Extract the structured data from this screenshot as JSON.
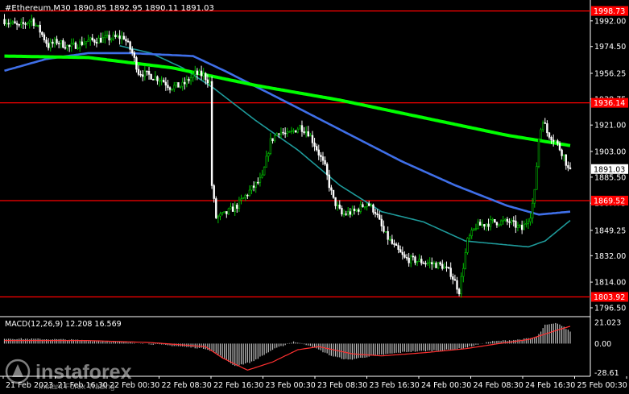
{
  "chart_data": {
    "type": "candlestick",
    "symbol_header": "#Ethereum,M30  1890.85 1892.95 1890.11 1891.03",
    "y_ticks": [
      "1992.00",
      "1974.50",
      "1956.25",
      "1938.75",
      "1921.00",
      "1903.00",
      "1885.50",
      "1867.75",
      "1849.25",
      "1832.00",
      "1814.00",
      "1796.50"
    ],
    "y_range": [
      1791.0,
      2004.0
    ],
    "current_price": "1891.03",
    "x_labels": [
      "21 Feb 2023",
      "21 Feb 16:30",
      "22 Feb 00:30",
      "22 Feb 08:30",
      "22 Feb 16:30",
      "23 Feb 00:30",
      "23 Feb 08:30",
      "23 Feb 16:30",
      "24 Feb 00:30",
      "24 Feb 08:30",
      "24 Feb 16:30",
      "25 Feb 00:30",
      "25 Feb 08:30"
    ],
    "levels": [
      {
        "value": 1998.73,
        "label": "1998.73"
      },
      {
        "value": 1936.14,
        "label": "1936.14"
      },
      {
        "value": 1869.52,
        "label": "1869.52"
      },
      {
        "value": 1803.92,
        "label": "1803.92"
      }
    ],
    "price_anchors": [
      [
        0,
        1993
      ],
      [
        8,
        1988
      ],
      [
        14,
        1993
      ],
      [
        18,
        1985
      ],
      [
        22,
        1975
      ],
      [
        26,
        1978
      ],
      [
        32,
        1974
      ],
      [
        40,
        1978
      ],
      [
        50,
        1980
      ],
      [
        58,
        1981
      ],
      [
        62,
        1970
      ],
      [
        65,
        1957
      ],
      [
        70,
        1955
      ],
      [
        76,
        1952
      ],
      [
        80,
        1947
      ],
      [
        86,
        1948
      ],
      [
        92,
        1956
      ],
      [
        96,
        1955
      ],
      [
        99,
        1950
      ],
      [
        100,
        1880
      ],
      [
        102,
        1858
      ],
      [
        106,
        1860
      ],
      [
        112,
        1866
      ],
      [
        118,
        1876
      ],
      [
        124,
        1885
      ],
      [
        128,
        1910
      ],
      [
        132,
        1917
      ],
      [
        136,
        1914
      ],
      [
        142,
        1920
      ],
      [
        146,
        1916
      ],
      [
        150,
        1905
      ],
      [
        154,
        1892
      ],
      [
        156,
        1880
      ],
      [
        158,
        1870
      ],
      [
        162,
        1860
      ],
      [
        168,
        1862
      ],
      [
        174,
        1868
      ],
      [
        178,
        1862
      ],
      [
        182,
        1848
      ],
      [
        186,
        1840
      ],
      [
        192,
        1830
      ],
      [
        200,
        1828
      ],
      [
        210,
        1825
      ],
      [
        214,
        1820
      ],
      [
        218,
        1808
      ],
      [
        220,
        1825
      ],
      [
        222,
        1842
      ],
      [
        226,
        1852
      ],
      [
        234,
        1855
      ],
      [
        242,
        1855
      ],
      [
        248,
        1850
      ],
      [
        252,
        1860
      ],
      [
        254,
        1875
      ],
      [
        256,
        1912
      ],
      [
        258,
        1925
      ],
      [
        260,
        1916
      ],
      [
        264,
        1910
      ],
      [
        268,
        1900
      ],
      [
        270,
        1891
      ]
    ],
    "ma_green": [
      [
        0,
        1968
      ],
      [
        40,
        1967
      ],
      [
        80,
        1960
      ],
      [
        120,
        1948
      ],
      [
        160,
        1938
      ],
      [
        200,
        1926
      ],
      [
        240,
        1914
      ],
      [
        270,
        1907
      ]
    ],
    "ma_blue": [
      [
        0,
        1958
      ],
      [
        20,
        1966
      ],
      [
        40,
        1970
      ],
      [
        60,
        1970
      ],
      [
        90,
        1968
      ],
      [
        105,
        1958
      ],
      [
        130,
        1940
      ],
      [
        160,
        1918
      ],
      [
        190,
        1896
      ],
      [
        215,
        1880
      ],
      [
        240,
        1866
      ],
      [
        255,
        1860
      ],
      [
        270,
        1862
      ]
    ],
    "ma_teal": [
      [
        55,
        1975
      ],
      [
        70,
        1970
      ],
      [
        85,
        1960
      ],
      [
        100,
        1946
      ],
      [
        120,
        1924
      ],
      [
        140,
        1904
      ],
      [
        160,
        1880
      ],
      [
        180,
        1862
      ],
      [
        200,
        1855
      ],
      [
        220,
        1842
      ],
      [
        235,
        1840
      ],
      [
        250,
        1838
      ],
      [
        258,
        1842
      ],
      [
        270,
        1856
      ]
    ],
    "macd": {
      "header": "MACD(12,26,9) 12.208 16.569",
      "y_ticks": [
        "21.023",
        "0.00",
        "-28.61"
      ],
      "y_range": [
        -32,
        24
      ],
      "hist_anchors": [
        [
          0,
          5
        ],
        [
          30,
          4
        ],
        [
          60,
          1
        ],
        [
          80,
          -2
        ],
        [
          96,
          -5
        ],
        [
          100,
          -8
        ],
        [
          110,
          -22
        ],
        [
          118,
          -18
        ],
        [
          128,
          -6
        ],
        [
          138,
          2
        ],
        [
          146,
          -2
        ],
        [
          156,
          -12
        ],
        [
          164,
          -16
        ],
        [
          176,
          -12
        ],
        [
          192,
          -8
        ],
        [
          214,
          -6
        ],
        [
          220,
          -4
        ],
        [
          232,
          2
        ],
        [
          246,
          4
        ],
        [
          254,
          6
        ],
        [
          258,
          18
        ],
        [
          264,
          20
        ],
        [
          270,
          12
        ]
      ],
      "signal_anchors": [
        [
          0,
          3
        ],
        [
          40,
          3
        ],
        [
          70,
          1
        ],
        [
          96,
          -3
        ],
        [
          104,
          -14
        ],
        [
          116,
          -26
        ],
        [
          128,
          -18
        ],
        [
          140,
          -6
        ],
        [
          150,
          -3
        ],
        [
          166,
          -10
        ],
        [
          180,
          -12
        ],
        [
          200,
          -9
        ],
        [
          220,
          -5
        ],
        [
          236,
          0
        ],
        [
          250,
          4
        ],
        [
          262,
          12
        ],
        [
          270,
          17
        ]
      ]
    }
  },
  "watermark": {
    "brand": "instaforex",
    "tagline": "Instant Forex Trading"
  },
  "colors": {
    "background": "#000000",
    "candle_up": "#00c000",
    "candle_down": "#ffffff",
    "ma_green": "#00ff00",
    "ma_blue": "#3f6fe8",
    "ma_teal": "#1e9a9a",
    "level_line": "#ff0000",
    "macd_hist": "#c0c0c0",
    "macd_signal": "#ff3030",
    "axis_text": "#ffffff"
  }
}
